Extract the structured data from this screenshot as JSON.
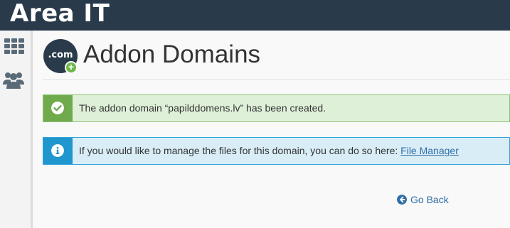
{
  "brand": {
    "title": "Area IT"
  },
  "sidebar": {
    "items": [
      {
        "name": "apps-grid",
        "icon": "grid-icon"
      },
      {
        "name": "users",
        "icon": "users-icon"
      }
    ]
  },
  "page": {
    "icon_text": ".com",
    "icon_badge": "+",
    "title": "Addon Domains"
  },
  "alerts": {
    "success": {
      "text": "The addon domain “papilddomens.lv” has been created.",
      "icon": "check-circle-icon",
      "color": "#6faa4c"
    },
    "info": {
      "text_prefix": "If you would like to manage the files for this domain, you can do so here: ",
      "link_label": "File Manager",
      "icon": "info-circle-icon",
      "color": "#1f96cd"
    }
  },
  "actions": {
    "go_back_label": "Go Back"
  },
  "colors": {
    "topbar": "#293a4a",
    "link": "#2f6ea5"
  }
}
